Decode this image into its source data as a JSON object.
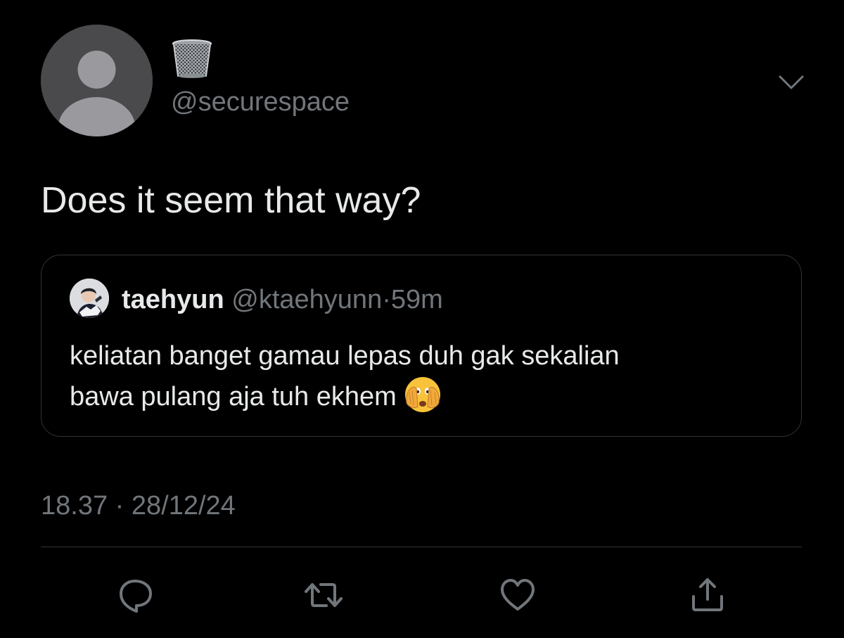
{
  "tweet": {
    "author_handle": "@securespace",
    "text": "Does it seem that way?",
    "timestamp": "18.37",
    "separator": "·",
    "date": "28/12/24"
  },
  "quoted_tweet": {
    "display_name": "taehyun",
    "handle": "@ktaehyunn",
    "separator": "·",
    "time": "59m",
    "text_line1": "keliatan banget gamau lepas duh gak sekalian",
    "text_line2": "bawa pulang aja tuh ekhem",
    "emoji": "face-with-open-eyes-and-hand-over-mouth"
  },
  "icons": {
    "author_display_name_emoji": "wastebasket",
    "more": "chevron-down-icon",
    "reply": "reply-icon",
    "retweet": "retweet-icon",
    "like": "heart-icon",
    "share": "share-icon"
  },
  "colors": {
    "background": "#000000",
    "primary_text": "#e7e9ea",
    "secondary_text": "#71767b",
    "border": "#2f3336",
    "avatar_placeholder": "#4a4a4c"
  }
}
